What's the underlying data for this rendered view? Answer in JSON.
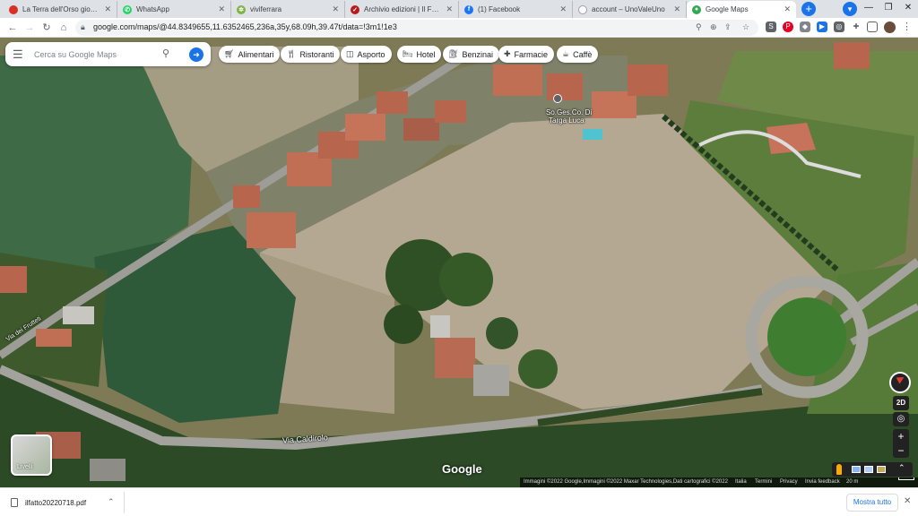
{
  "browser": {
    "tabs": [
      {
        "title": "La Terra dell'Orso giochi e gi",
        "favicon": "red-circle-icon"
      },
      {
        "title": "WhatsApp",
        "favicon": "whatsapp-icon"
      },
      {
        "title": "viviferrara",
        "favicon": "viviferrara-icon"
      },
      {
        "title": "Archivio edizioni | Il Fatto Q",
        "favicon": "ilfatto-icon"
      },
      {
        "title": "(1) Facebook",
        "favicon": "facebook-icon"
      },
      {
        "title": "account – UnoValeUno",
        "favicon": "loading-icon"
      },
      {
        "title": "Google Maps",
        "favicon": "google-maps-icon",
        "active": true
      }
    ],
    "new_tab": "+",
    "url": "google.com/maps/@44.8349655,11.6352465,236a,35y,68.09h,39.47t/data=!3m1!1e3"
  },
  "maps": {
    "search_placeholder": "Cerca su Google Maps",
    "chips": [
      {
        "label": "Alimentari",
        "icon": "cart-icon"
      },
      {
        "label": "Ristoranti",
        "icon": "cutlery-icon"
      },
      {
        "label": "Asporto",
        "icon": "takeout-icon"
      },
      {
        "label": "Hotel",
        "icon": "bed-icon"
      },
      {
        "label": "Benzinai",
        "icon": "fuel-icon"
      },
      {
        "label": "Farmacie",
        "icon": "pharmacy-icon"
      },
      {
        "label": "Caffè",
        "icon": "coffee-icon"
      }
    ],
    "poi_label_1": "So.Ges.Co. Di",
    "poi_label_2": "Targa Luca",
    "road_1": "Via Caldirolo",
    "road_2": "Via dei Frutteti",
    "layers_label": "Livelli",
    "logo": "Google",
    "view_2d": "2D",
    "zoom_in": "+",
    "zoom_out": "−",
    "footer": {
      "imagery": "Immagini ©2022 Google,Immagini ©2022 Maxar Technologies,Dati cartografici ©2022",
      "country": "Italia",
      "terms": "Termini",
      "privacy": "Privacy",
      "feedback": "Invia feedback",
      "scale": "20 m"
    }
  },
  "downloads": {
    "filename": "ilfatto20220718.pdf",
    "show_all": "Mostra tutto"
  }
}
